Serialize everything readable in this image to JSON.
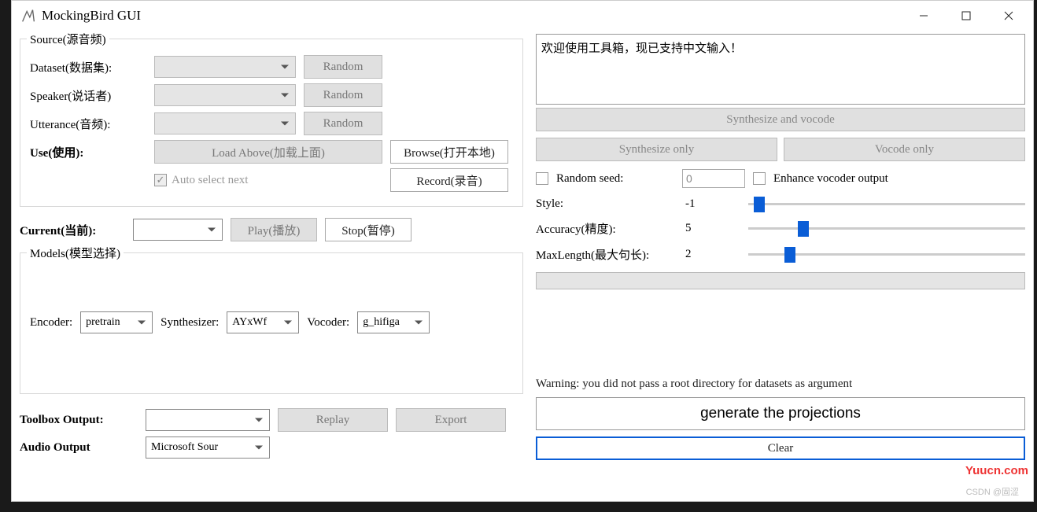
{
  "window": {
    "title": "MockingBird GUI"
  },
  "source": {
    "legend": "Source(源音频)",
    "dataset_label": "Dataset(数据集):",
    "speaker_label": "Speaker(说话者)",
    "utterance_label": "Utterance(音频):",
    "use_label": "Use(使用):",
    "random_btn": "Random",
    "load_above_btn": "Load Above(加载上面)",
    "browse_btn": "Browse(打开本地)",
    "auto_select_label": "Auto select next",
    "record_btn": "Record(录音)"
  },
  "current": {
    "label": "Current(当前):",
    "play_btn": "Play(播放)",
    "stop_btn": "Stop(暂停)"
  },
  "models": {
    "legend": "Models(模型选择)",
    "encoder_label": "Encoder:",
    "encoder_value": "pretrain",
    "synth_label": "Synthesizer:",
    "synth_value": "AYxWf",
    "vocoder_label": "Vocoder:",
    "vocoder_value": "g_hifiga"
  },
  "outputs": {
    "toolbox_label": "Toolbox Output:",
    "replay_btn": "Replay",
    "export_btn": "Export",
    "audio_label": "Audio Output",
    "audio_value": "Microsoft Sour"
  },
  "right": {
    "welcome_text": "欢迎使用工具箱，现已支持中文输入！",
    "synth_vocode_btn": "Synthesize and vocode",
    "synth_only_btn": "Synthesize only",
    "vocode_only_btn": "Vocode only",
    "random_seed_label": "Random seed:",
    "random_seed_value": "0",
    "enhance_label": "Enhance vocoder output",
    "style_label": "Style:",
    "style_value": "-1",
    "accuracy_label": "Accuracy(精度):",
    "accuracy_value": "5",
    "maxlen_label": "MaxLength(最大句长):",
    "maxlen_value": "2",
    "warning_text": "Warning: you did not pass a root directory for datasets as argument",
    "input_text": "generate the projections",
    "clear_btn": "Clear"
  },
  "watermark": "Yuucn.com",
  "csdn": "CSDN @固涩"
}
